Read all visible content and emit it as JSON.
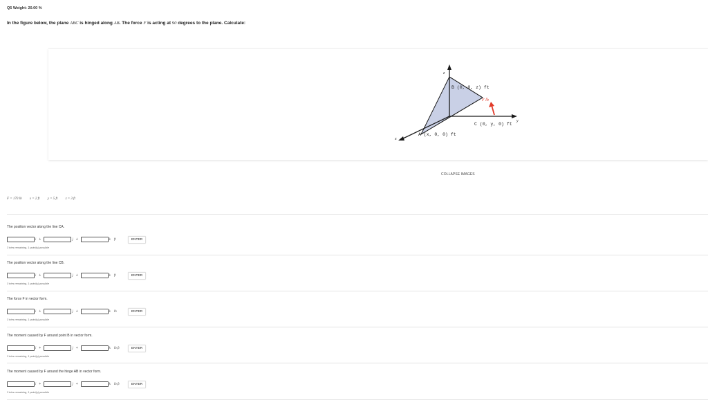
{
  "header": {
    "weight": "Q5 Weight: 20.00 %",
    "question_prefix": "In the figure below, the plane ",
    "plane": "ABC",
    "question_mid1": " is hinged along ",
    "hinge": "AB",
    "question_mid2": ". The force ",
    "force": "F",
    "question_mid3": " is acting at ",
    "angle": "90",
    "question_suffix": " degrees to the plane. Calculate:"
  },
  "figure": {
    "axis_z": "z",
    "axis_y": "y",
    "axis_x": "x",
    "label_B": "B (0, 0, z) ft",
    "label_C": "C (0, y, 0) ft",
    "label_A": "A (x, 0, 0) ft",
    "label_F": "F lb",
    "plane_color": "#c9d0e6",
    "force_color": "#e23b2a"
  },
  "collapse_label": "COLLAPSE IMAGES",
  "given": [
    "F = 170 lb",
    "x = 2 ft",
    "y = 5 ft",
    "z = 3 ft"
  ],
  "parts": [
    {
      "title": "The position vector along the line CA.",
      "unit": "ft",
      "enter": "ENTER",
      "tries": "3 tries remaining, 1 point(s) possible",
      "vec": [
        "i",
        "j",
        "k"
      ]
    },
    {
      "title": "The position vector along the line CB.",
      "unit": "ft",
      "enter": "ENTER",
      "tries": "3 tries remaining, 1 point(s) possible",
      "vec": [
        "i",
        "j",
        "k"
      ]
    },
    {
      "title": "The force F in vector form.",
      "unit": "lb",
      "enter": "ENTER",
      "tries": "3 tries remaining, 1 point(s) possible",
      "vec": [
        "i",
        "j",
        "k"
      ]
    },
    {
      "title": "The moment caused by F around point B in vector form.",
      "unit": "lb.ft",
      "enter": "ENTER",
      "tries": "3 tries remaining, 1 point(s) possible",
      "vec": [
        "i",
        "j",
        "k"
      ]
    },
    {
      "title": "The moment caused by F around the hinge AB in vector form.",
      "unit": "lb.ft",
      "enter": "ENTER",
      "tries": "3 tries remaining, 1 point(s) possible",
      "vec": [
        "i",
        "j",
        "k"
      ]
    }
  ]
}
